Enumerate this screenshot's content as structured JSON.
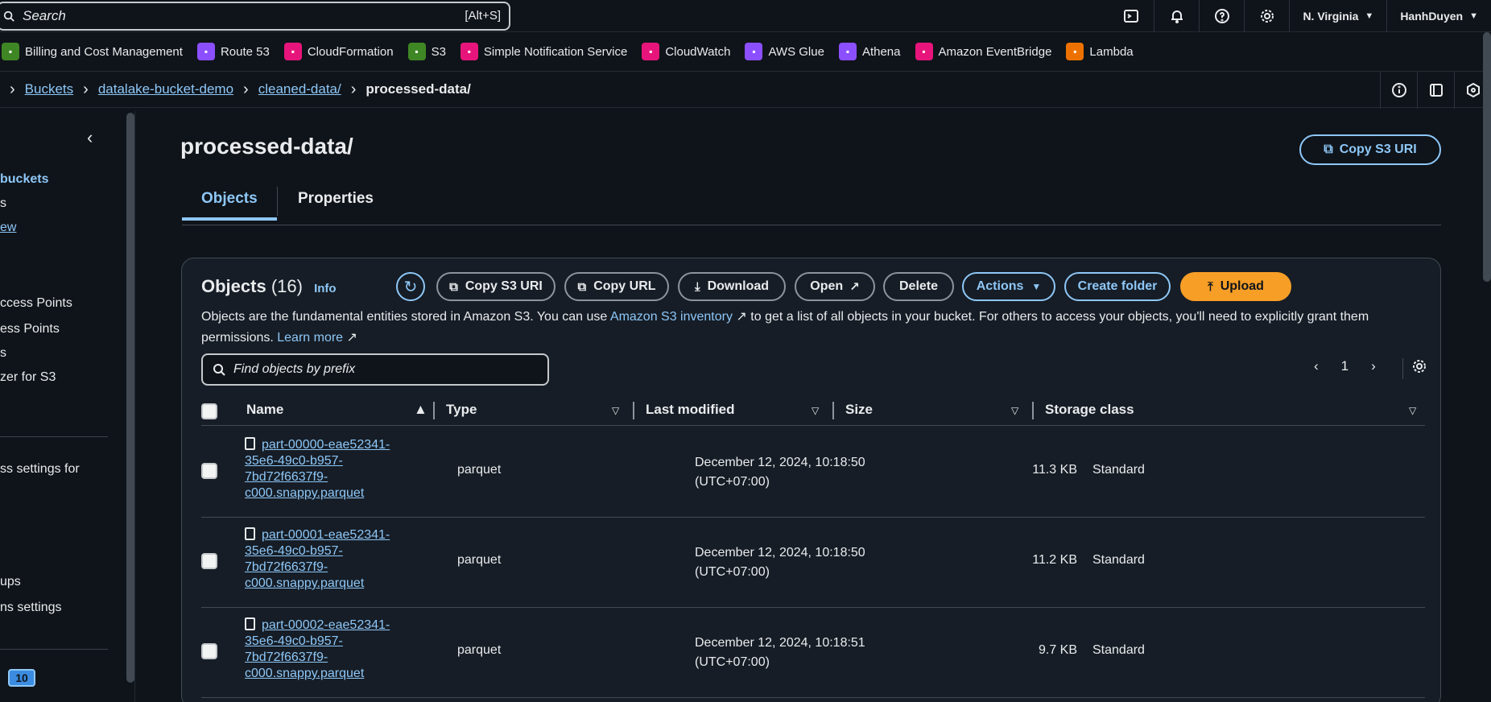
{
  "topbar": {
    "search_placeholder": "Search",
    "search_shortcut": "[Alt+S]",
    "region": "N. Virginia",
    "user": "HanhDuyen"
  },
  "favorites": [
    {
      "label": "Billing and Cost Management",
      "color": "#3f8624"
    },
    {
      "label": "Route 53",
      "color": "#8c4fff"
    },
    {
      "label": "CloudFormation",
      "color": "#e7157b"
    },
    {
      "label": "S3",
      "color": "#3f8624"
    },
    {
      "label": "Simple Notification Service",
      "color": "#e7157b"
    },
    {
      "label": "CloudWatch",
      "color": "#e7157b"
    },
    {
      "label": "AWS Glue",
      "color": "#8c4fff"
    },
    {
      "label": "Athena",
      "color": "#8c4fff"
    },
    {
      "label": "Amazon EventBridge",
      "color": "#e7157b"
    },
    {
      "label": "Lambda",
      "color": "#ed7100"
    }
  ],
  "breadcrumb": {
    "items": [
      "Buckets",
      "datalake-bucket-demo",
      "cleaned-data/"
    ],
    "current": "processed-data/"
  },
  "sidebar": {
    "items": [
      {
        "label": "buckets"
      },
      {
        "label": "s"
      },
      {
        "label": "ew"
      },
      {
        "label": "ccess Points"
      },
      {
        "label": "ess Points"
      },
      {
        "label": "s"
      },
      {
        "label": "zer for S3"
      },
      {
        "label": "ss settings for"
      },
      {
        "label": "ups"
      },
      {
        "label": "ns settings"
      }
    ],
    "badge": "10"
  },
  "page": {
    "title": "processed-data/",
    "copy_uri": "Copy S3 URI",
    "tabs": [
      "Objects",
      "Properties"
    ]
  },
  "objects_panel": {
    "title": "Objects",
    "count": "(16)",
    "info": "Info",
    "buttons": {
      "copy_s3_uri": "Copy S3 URI",
      "copy_url": "Copy URL",
      "download": "Download",
      "open": "Open",
      "delete": "Delete",
      "actions": "Actions",
      "create_folder": "Create folder",
      "upload": "Upload"
    },
    "desc_1": "Objects are the fundamental entities stored in Amazon S3. You can use ",
    "desc_link": "Amazon S3 inventory",
    "desc_2": " to get a list of all objects in your bucket. For others to access your objects, you'll need to explicitly grant them permissions. ",
    "desc_learn": "Learn more",
    "filter_placeholder": "Find objects by prefix",
    "page_num": "1",
    "columns": [
      "Name",
      "Type",
      "Last modified",
      "Size",
      "Storage class"
    ],
    "rows": [
      {
        "name": "part-00000-eae52341-35e6-49c0-b957-7bd72f6637f9-c000.snappy.parquet",
        "type": "parquet",
        "modified": "December 12, 2024, 10:18:50",
        "tz": "(UTC+07:00)",
        "size": "11.3 KB",
        "storage": "Standard"
      },
      {
        "name": "part-00001-eae52341-35e6-49c0-b957-7bd72f6637f9-c000.snappy.parquet",
        "type": "parquet",
        "modified": "December 12, 2024, 10:18:50",
        "tz": "(UTC+07:00)",
        "size": "11.2 KB",
        "storage": "Standard"
      },
      {
        "name": "part-00002-eae52341-35e6-49c0-b957-7bd72f6637f9-c000.snappy.parquet",
        "type": "parquet",
        "modified": "December 12, 2024, 10:18:51",
        "tz": "(UTC+07:00)",
        "size": "9.7 KB",
        "storage": "Standard"
      }
    ]
  }
}
